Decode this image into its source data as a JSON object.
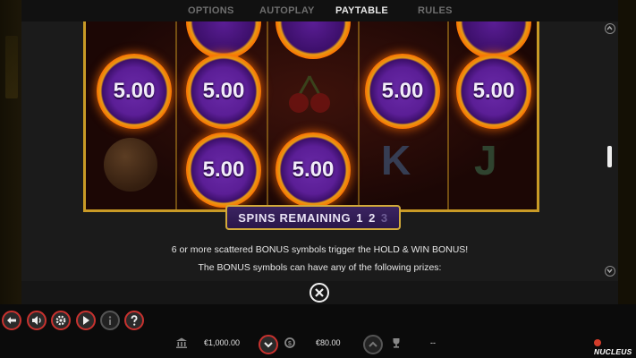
{
  "tabs": [
    {
      "label": "OPTIONS"
    },
    {
      "label": "AUTOPLAY"
    },
    {
      "label": "PAYTABLE",
      "active": true
    },
    {
      "label": "RULES"
    }
  ],
  "game_image": {
    "coin_values": [
      "5.00",
      "5.00",
      "5.00",
      "5.00",
      "5.00",
      "5.00"
    ],
    "reel_symbols": [
      "K",
      "J"
    ],
    "spins_label": "SPINS REMAINING",
    "spins_counts": [
      "1",
      "2",
      "3"
    ]
  },
  "description": {
    "line1": "6 or more scattered BONUS symbols trigger the HOLD & WIN BONUS!",
    "line2": "The BONUS symbols can have any of the following prizes:"
  },
  "footer": {
    "balance": "€1,000.00",
    "bet": "€80.00",
    "win": "--",
    "logo_text": "NUCLEUS"
  },
  "colors": {
    "accent_red": "#c8322f",
    "gold": "#c99a26",
    "purple": "#5b1e96"
  },
  "icons": [
    "back-icon",
    "sound-icon",
    "settings-icon",
    "play-icon",
    "info-icon",
    "help-icon",
    "bank-icon",
    "coins-icon",
    "trophy-icon",
    "chevron-down-icon",
    "chevron-up-icon",
    "close-icon"
  ]
}
